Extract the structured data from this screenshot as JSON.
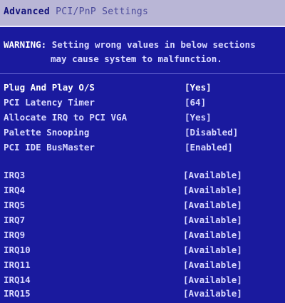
{
  "header": {
    "title_prefix": "Advanced",
    "title_suffix": "PCI/PnP Settings"
  },
  "warning": {
    "label": "WARNING:",
    "line1": " Setting wrong values in below sections",
    "line2": "may cause system to malfunction."
  },
  "settings": [
    {
      "label": "Plug And Play O/S",
      "value": "[Yes]"
    },
    {
      "label": "PCI Latency Timer",
      "value": "[64]"
    },
    {
      "label": "Allocate IRQ to PCI VGA",
      "value": "[Yes]"
    },
    {
      "label": "Palette Snooping",
      "value": "[Disabled]"
    },
    {
      "label": "PCI IDE BusMaster",
      "value": "[Enabled]"
    }
  ],
  "irqs": [
    {
      "label": "IRQ3",
      "value": "[Available]"
    },
    {
      "label": "IRQ4",
      "value": "[Available]"
    },
    {
      "label": "IRQ5",
      "value": "[Available]"
    },
    {
      "label": "IRQ7",
      "value": "[Available]"
    },
    {
      "label": "IRQ9",
      "value": "[Available]"
    },
    {
      "label": "IRQ10",
      "value": "[Available]"
    },
    {
      "label": "IRQ11",
      "value": "[Available]"
    },
    {
      "label": "IRQ14",
      "value": "[Available]"
    },
    {
      "label": "IRQ15",
      "value": "[Available]"
    }
  ]
}
